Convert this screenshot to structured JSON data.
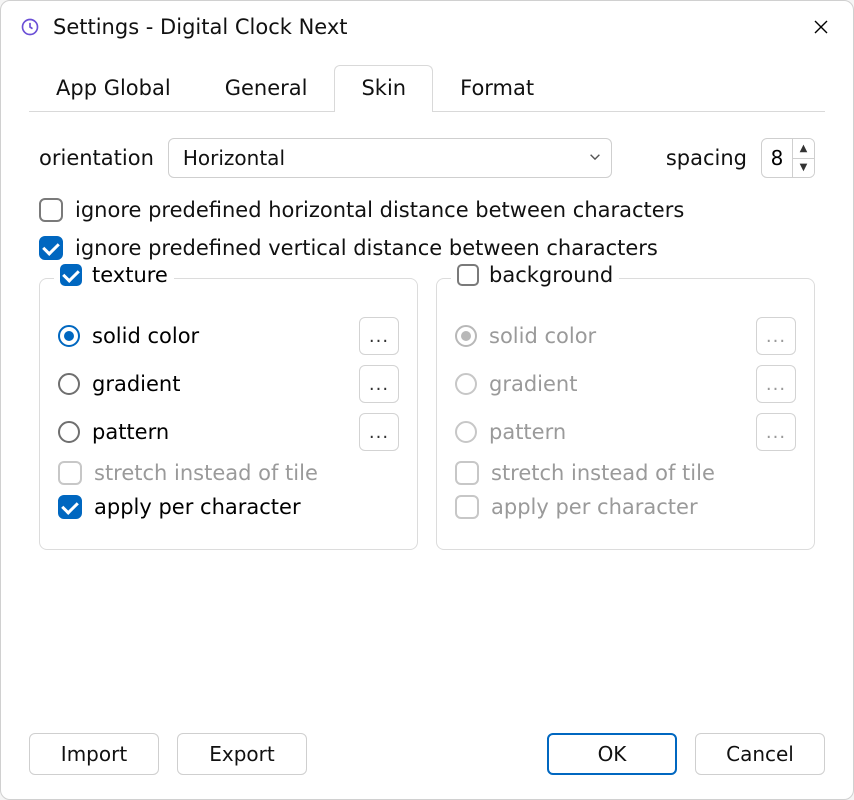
{
  "window": {
    "title": "Settings - Digital Clock Next"
  },
  "tabs": {
    "app_global": "App Global",
    "general": "General",
    "skin": "Skin",
    "format": "Format",
    "active": "skin"
  },
  "skin": {
    "orientation_label": "orientation",
    "orientation_value": "Horizontal",
    "spacing_label": "spacing",
    "spacing_value": "8",
    "ignore_h": {
      "label": "ignore predefined horizontal distance between characters",
      "checked": false
    },
    "ignore_v": {
      "label": "ignore predefined vertical distance between characters",
      "checked": true
    },
    "texture": {
      "legend": "texture",
      "enabled": true,
      "options": {
        "solid": "solid color",
        "gradient": "gradient",
        "pattern": "pattern",
        "selected": "solid"
      },
      "stretch": {
        "label": "stretch instead of tile",
        "checked": false,
        "enabled": false
      },
      "apply_per_char": {
        "label": "apply per character",
        "checked": true,
        "enabled": true
      }
    },
    "background": {
      "legend": "background",
      "enabled": false,
      "options": {
        "solid": "solid color",
        "gradient": "gradient",
        "pattern": "pattern",
        "selected": "solid"
      },
      "stretch": {
        "label": "stretch instead of tile",
        "checked": false,
        "enabled": false
      },
      "apply_per_char": {
        "label": "apply per character",
        "checked": false,
        "enabled": false
      }
    }
  },
  "footer": {
    "import": "Import",
    "export": "Export",
    "ok": "OK",
    "cancel": "Cancel"
  },
  "misc": {
    "ellipsis": "..."
  }
}
